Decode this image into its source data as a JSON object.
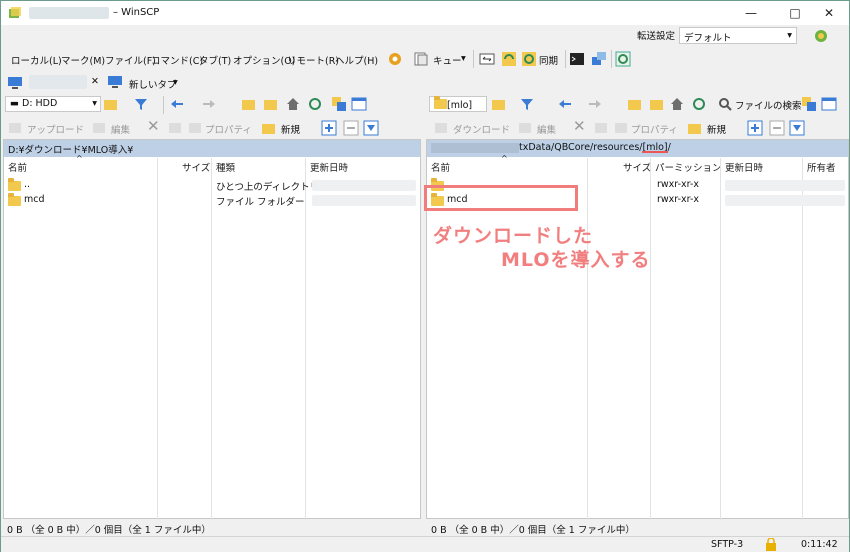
{
  "window": {
    "title": "– WinSCP"
  },
  "window_controls": {
    "minimize": "—",
    "maximize": "□",
    "close": "✕"
  },
  "menu": [
    "ローカル(L)",
    "マーク(M)",
    "ファイル(F)",
    "コマンド(C)",
    "タブ(T)",
    "オプション(O)",
    "リモート(R)",
    "ヘルプ(H)"
  ],
  "toolbar": {
    "queue_label": "キュー",
    "sync_label": "同期",
    "transfer_label": "転送設定",
    "transfer_value": "デフォルト"
  },
  "session": {
    "close": "✕",
    "new_tab_label": "新しいタブ"
  },
  "left": {
    "drive": "D: HDD",
    "upload_label": "アップロード",
    "edit_label": "編集",
    "properties_label": "プロパティ",
    "new_label": "新規",
    "path": "D:¥ダウンロード¥MLO導入¥",
    "columns": {
      "name": "名前",
      "size": "サイズ",
      "type": "種類",
      "modified": "更新日時"
    },
    "rows": [
      {
        "name": "..",
        "type": "ひとつ上のディレクトリ"
      },
      {
        "name": "mcd",
        "type": "ファイル フォルダー"
      }
    ],
    "status": "0 B （全 0 B 中）／0 個目（全 1 ファイル中）"
  },
  "right": {
    "dir": "[mlo]",
    "find_label": "ファイルの検索",
    "download_label": "ダウンロード",
    "edit_label": "編集",
    "properties_label": "プロパティ",
    "new_label": "新規",
    "path": "txData/QBCore/resources/[mlo]/",
    "columns": {
      "name": "名前",
      "size": "サイズ",
      "perm": "パーミッション",
      "modified": "更新日時",
      "owner": "所有者"
    },
    "rows": [
      {
        "name": "",
        "perm": "rwxr-xr-x"
      },
      {
        "name": "mcd",
        "perm": "rwxr-xr-x"
      }
    ],
    "status": "0 B （全 0 B 中）／0 個目（全 1 ファイル中）"
  },
  "bottom": {
    "protocol": "SFTP-3",
    "time": "0:11:42"
  },
  "annotation": {
    "line1": "ダウンロードした",
    "line2": "MLOを導入する",
    "color": "#f27f7f"
  }
}
